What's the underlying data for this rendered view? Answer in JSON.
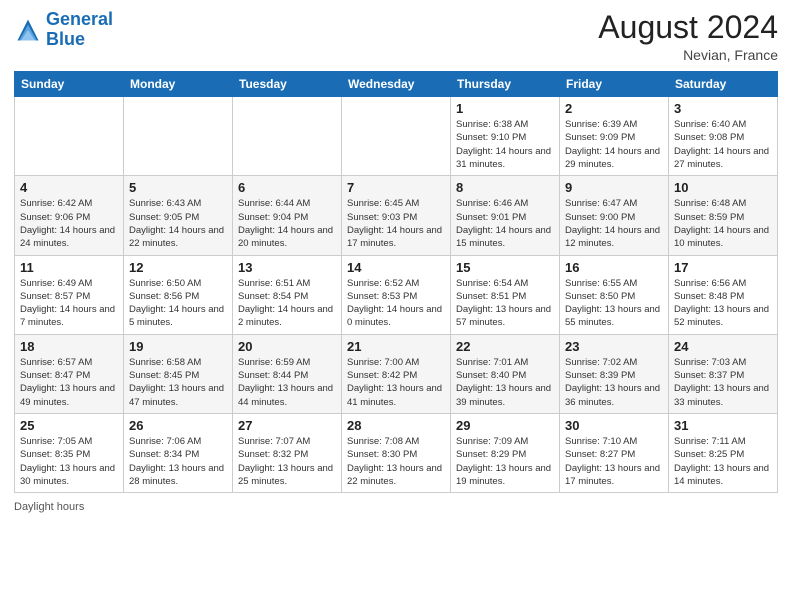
{
  "header": {
    "logo_line1": "General",
    "logo_line2": "Blue",
    "month_year": "August 2024",
    "location": "Nevian, France"
  },
  "footer": {
    "daylight_label": "Daylight hours"
  },
  "weekdays": [
    "Sunday",
    "Monday",
    "Tuesday",
    "Wednesday",
    "Thursday",
    "Friday",
    "Saturday"
  ],
  "weeks": [
    [
      {
        "day": "",
        "info": ""
      },
      {
        "day": "",
        "info": ""
      },
      {
        "day": "",
        "info": ""
      },
      {
        "day": "",
        "info": ""
      },
      {
        "day": "1",
        "info": "Sunrise: 6:38 AM\nSunset: 9:10 PM\nDaylight: 14 hours and 31 minutes."
      },
      {
        "day": "2",
        "info": "Sunrise: 6:39 AM\nSunset: 9:09 PM\nDaylight: 14 hours and 29 minutes."
      },
      {
        "day": "3",
        "info": "Sunrise: 6:40 AM\nSunset: 9:08 PM\nDaylight: 14 hours and 27 minutes."
      }
    ],
    [
      {
        "day": "4",
        "info": "Sunrise: 6:42 AM\nSunset: 9:06 PM\nDaylight: 14 hours and 24 minutes."
      },
      {
        "day": "5",
        "info": "Sunrise: 6:43 AM\nSunset: 9:05 PM\nDaylight: 14 hours and 22 minutes."
      },
      {
        "day": "6",
        "info": "Sunrise: 6:44 AM\nSunset: 9:04 PM\nDaylight: 14 hours and 20 minutes."
      },
      {
        "day": "7",
        "info": "Sunrise: 6:45 AM\nSunset: 9:03 PM\nDaylight: 14 hours and 17 minutes."
      },
      {
        "day": "8",
        "info": "Sunrise: 6:46 AM\nSunset: 9:01 PM\nDaylight: 14 hours and 15 minutes."
      },
      {
        "day": "9",
        "info": "Sunrise: 6:47 AM\nSunset: 9:00 PM\nDaylight: 14 hours and 12 minutes."
      },
      {
        "day": "10",
        "info": "Sunrise: 6:48 AM\nSunset: 8:59 PM\nDaylight: 14 hours and 10 minutes."
      }
    ],
    [
      {
        "day": "11",
        "info": "Sunrise: 6:49 AM\nSunset: 8:57 PM\nDaylight: 14 hours and 7 minutes."
      },
      {
        "day": "12",
        "info": "Sunrise: 6:50 AM\nSunset: 8:56 PM\nDaylight: 14 hours and 5 minutes."
      },
      {
        "day": "13",
        "info": "Sunrise: 6:51 AM\nSunset: 8:54 PM\nDaylight: 14 hours and 2 minutes."
      },
      {
        "day": "14",
        "info": "Sunrise: 6:52 AM\nSunset: 8:53 PM\nDaylight: 14 hours and 0 minutes."
      },
      {
        "day": "15",
        "info": "Sunrise: 6:54 AM\nSunset: 8:51 PM\nDaylight: 13 hours and 57 minutes."
      },
      {
        "day": "16",
        "info": "Sunrise: 6:55 AM\nSunset: 8:50 PM\nDaylight: 13 hours and 55 minutes."
      },
      {
        "day": "17",
        "info": "Sunrise: 6:56 AM\nSunset: 8:48 PM\nDaylight: 13 hours and 52 minutes."
      }
    ],
    [
      {
        "day": "18",
        "info": "Sunrise: 6:57 AM\nSunset: 8:47 PM\nDaylight: 13 hours and 49 minutes."
      },
      {
        "day": "19",
        "info": "Sunrise: 6:58 AM\nSunset: 8:45 PM\nDaylight: 13 hours and 47 minutes."
      },
      {
        "day": "20",
        "info": "Sunrise: 6:59 AM\nSunset: 8:44 PM\nDaylight: 13 hours and 44 minutes."
      },
      {
        "day": "21",
        "info": "Sunrise: 7:00 AM\nSunset: 8:42 PM\nDaylight: 13 hours and 41 minutes."
      },
      {
        "day": "22",
        "info": "Sunrise: 7:01 AM\nSunset: 8:40 PM\nDaylight: 13 hours and 39 minutes."
      },
      {
        "day": "23",
        "info": "Sunrise: 7:02 AM\nSunset: 8:39 PM\nDaylight: 13 hours and 36 minutes."
      },
      {
        "day": "24",
        "info": "Sunrise: 7:03 AM\nSunset: 8:37 PM\nDaylight: 13 hours and 33 minutes."
      }
    ],
    [
      {
        "day": "25",
        "info": "Sunrise: 7:05 AM\nSunset: 8:35 PM\nDaylight: 13 hours and 30 minutes."
      },
      {
        "day": "26",
        "info": "Sunrise: 7:06 AM\nSunset: 8:34 PM\nDaylight: 13 hours and 28 minutes."
      },
      {
        "day": "27",
        "info": "Sunrise: 7:07 AM\nSunset: 8:32 PM\nDaylight: 13 hours and 25 minutes."
      },
      {
        "day": "28",
        "info": "Sunrise: 7:08 AM\nSunset: 8:30 PM\nDaylight: 13 hours and 22 minutes."
      },
      {
        "day": "29",
        "info": "Sunrise: 7:09 AM\nSunset: 8:29 PM\nDaylight: 13 hours and 19 minutes."
      },
      {
        "day": "30",
        "info": "Sunrise: 7:10 AM\nSunset: 8:27 PM\nDaylight: 13 hours and 17 minutes."
      },
      {
        "day": "31",
        "info": "Sunrise: 7:11 AM\nSunset: 8:25 PM\nDaylight: 13 hours and 14 minutes."
      }
    ]
  ]
}
